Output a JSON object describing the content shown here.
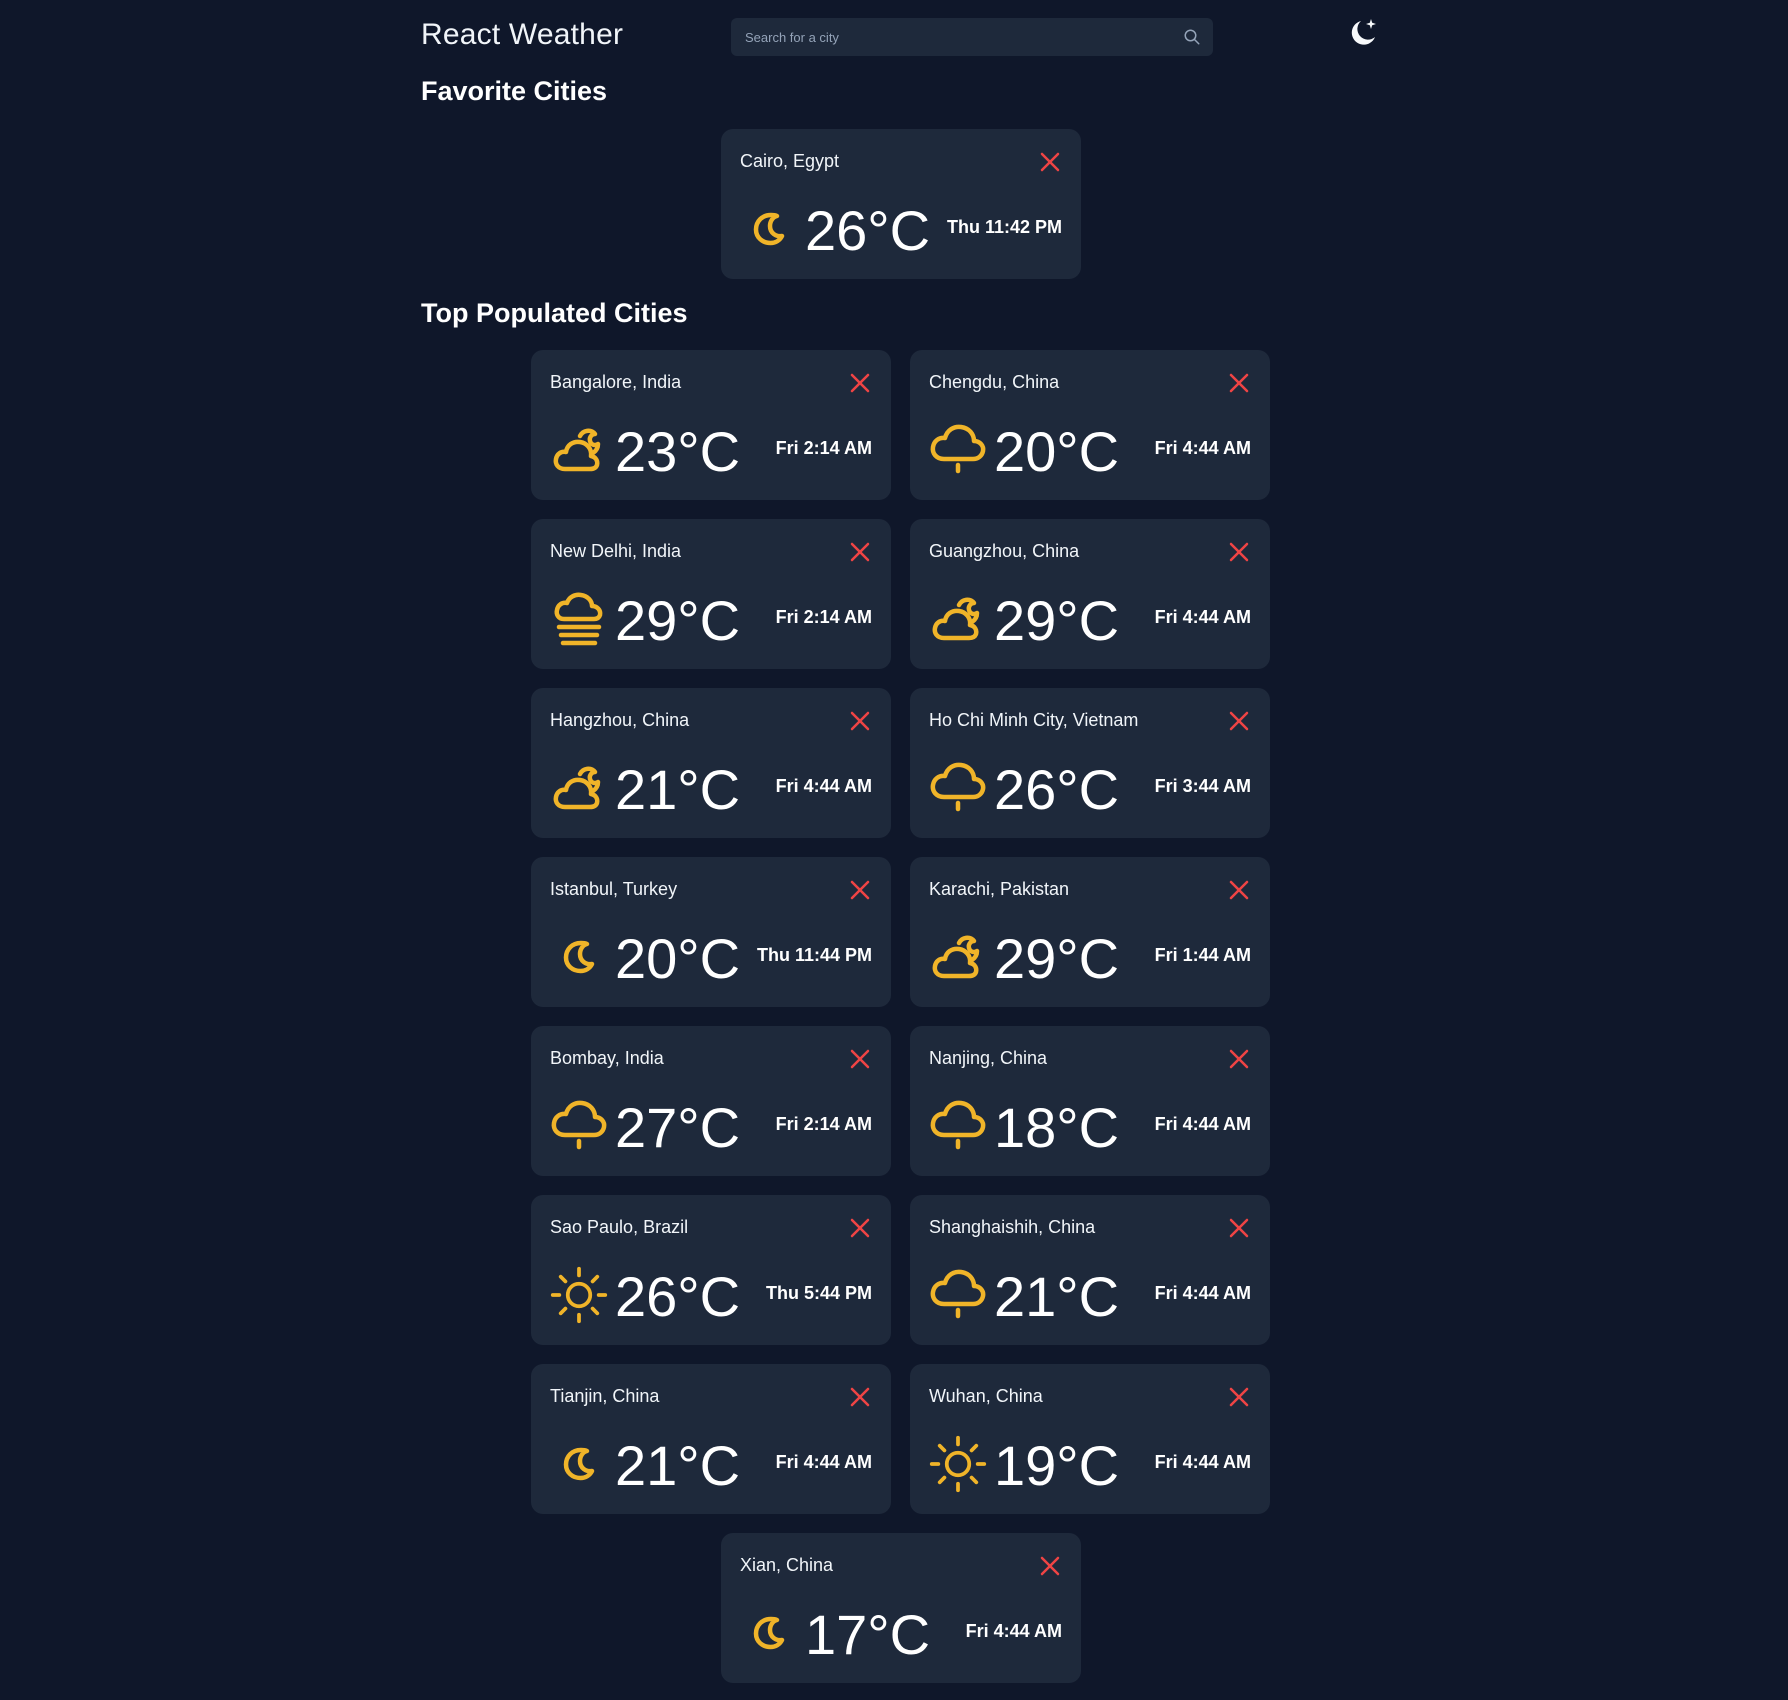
{
  "header": {
    "app_title": "React Weather",
    "search_placeholder": "Search for a city",
    "search_icon": "magnifier-icon",
    "theme_icon": "moon-star-icon"
  },
  "sections": {
    "favorites_title": "Favorite Cities",
    "top_title": "Top Populated Cities"
  },
  "colors": {
    "background": "#0f172a",
    "card": "#1e293b",
    "icon_accent": "#f0b429",
    "close": "#ef4444"
  },
  "favorites": [
    {
      "city": "Cairo, Egypt",
      "temp": "26°C",
      "time": "Thu 11:42 PM",
      "icon": "moon-icon"
    }
  ],
  "top_cities": [
    {
      "city": "Bangalore, India",
      "temp": "23°C",
      "time": "Fri 2:14 AM",
      "icon": "cloud-moon-icon"
    },
    {
      "city": "Chengdu, China",
      "temp": "20°C",
      "time": "Fri 4:44 AM",
      "icon": "cloud-drizzle-icon"
    },
    {
      "city": "New Delhi, India",
      "temp": "29°C",
      "time": "Fri 2:14 AM",
      "icon": "cloud-fog-icon"
    },
    {
      "city": "Guangzhou, China",
      "temp": "29°C",
      "time": "Fri 4:44 AM",
      "icon": "cloud-moon-icon"
    },
    {
      "city": "Hangzhou, China",
      "temp": "21°C",
      "time": "Fri 4:44 AM",
      "icon": "cloud-moon-icon"
    },
    {
      "city": "Ho Chi Minh City, Vietnam",
      "temp": "26°C",
      "time": "Fri 3:44 AM",
      "icon": "cloud-drizzle-icon"
    },
    {
      "city": "Istanbul, Turkey",
      "temp": "20°C",
      "time": "Thu 11:44 PM",
      "icon": "moon-icon"
    },
    {
      "city": "Karachi, Pakistan",
      "temp": "29°C",
      "time": "Fri 1:44 AM",
      "icon": "cloud-moon-icon"
    },
    {
      "city": "Bombay, India",
      "temp": "27°C",
      "time": "Fri 2:14 AM",
      "icon": "cloud-drizzle-icon"
    },
    {
      "city": "Nanjing, China",
      "temp": "18°C",
      "time": "Fri 4:44 AM",
      "icon": "cloud-drizzle-icon"
    },
    {
      "city": "Sao Paulo, Brazil",
      "temp": "26°C",
      "time": "Thu 5:44 PM",
      "icon": "sun-icon"
    },
    {
      "city": "Shanghaishih, China",
      "temp": "21°C",
      "time": "Fri 4:44 AM",
      "icon": "cloud-drizzle-icon"
    },
    {
      "city": "Tianjin, China",
      "temp": "21°C",
      "time": "Fri 4:44 AM",
      "icon": "moon-icon"
    },
    {
      "city": "Wuhan, China",
      "temp": "19°C",
      "time": "Fri 4:44 AM",
      "icon": "sun-icon"
    },
    {
      "city": "Xian, China",
      "temp": "17°C",
      "time": "Fri 4:44 AM",
      "icon": "moon-icon"
    }
  ]
}
